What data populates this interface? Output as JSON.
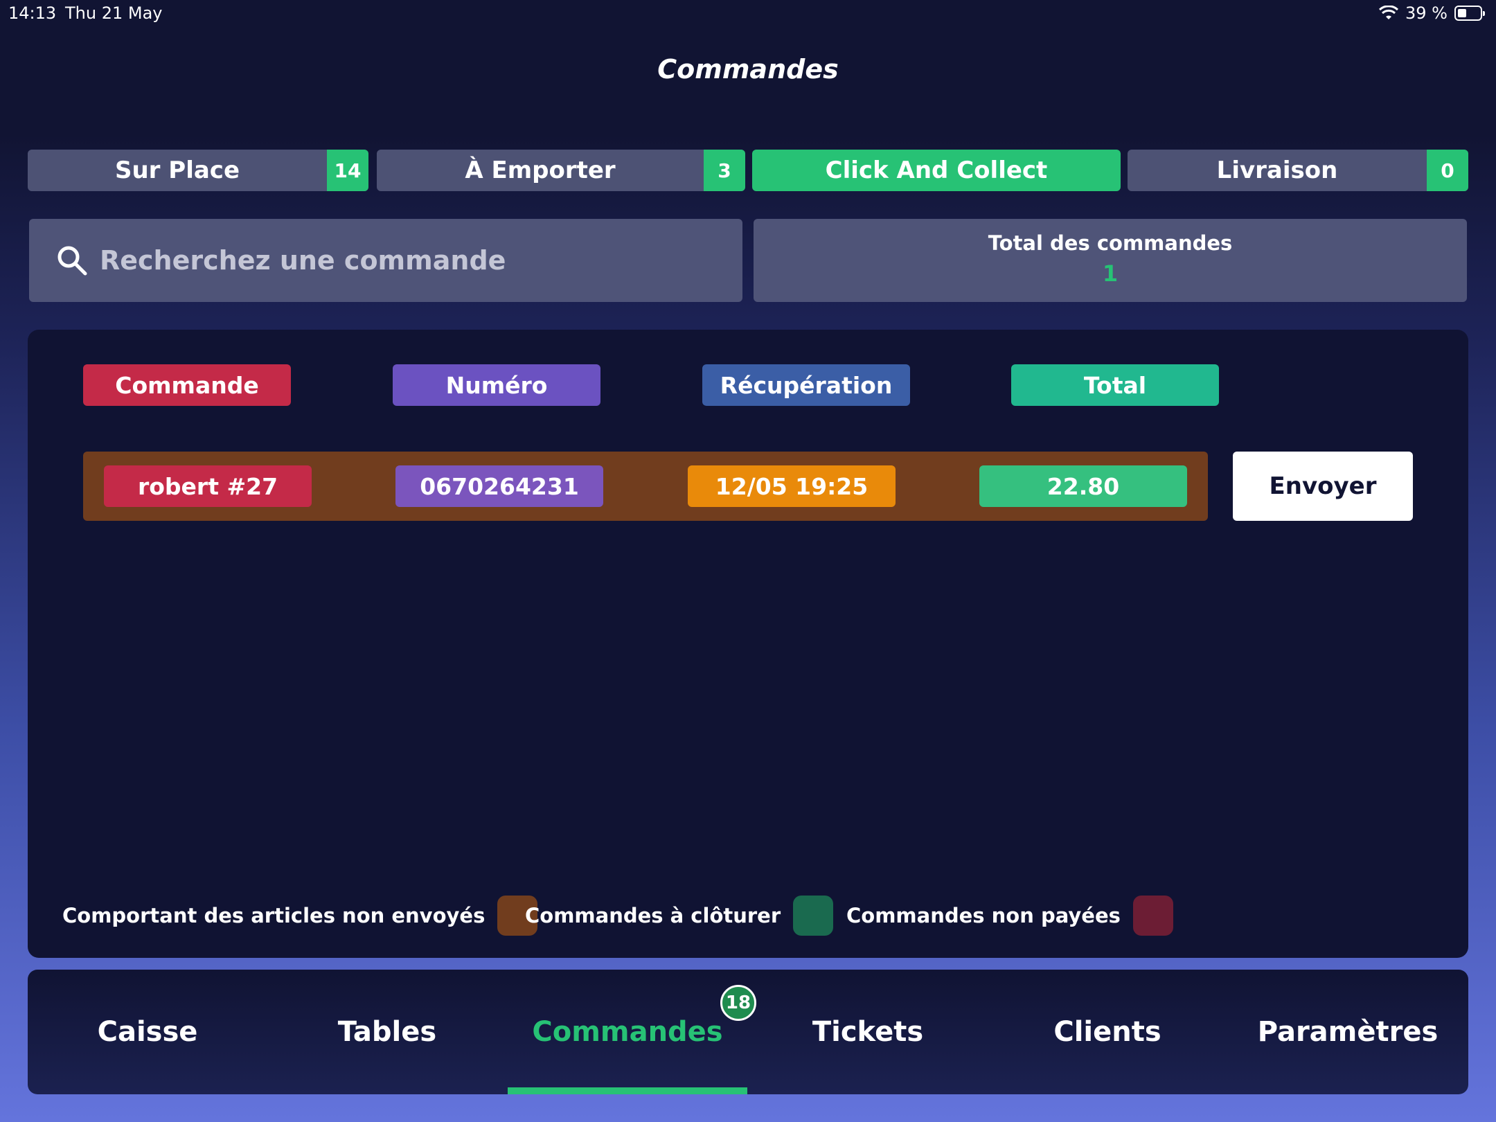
{
  "status_bar": {
    "time": "14:13",
    "date": "Thu 21 May",
    "battery": "39 %"
  },
  "header": {
    "title": "Commandes"
  },
  "tabs": [
    {
      "label": "Sur Place",
      "count": "14"
    },
    {
      "label": "À Emporter",
      "count": "3"
    },
    {
      "label": "Click And Collect",
      "count": ""
    },
    {
      "label": "Livraison",
      "count": "0"
    }
  ],
  "search": {
    "placeholder": "Recherchez une commande"
  },
  "totals": {
    "label": "Total des commandes",
    "value": "1"
  },
  "table": {
    "headers": [
      "Commande",
      "Numéro",
      "Récupération",
      "Total"
    ],
    "rows": [
      {
        "commande": "robert #27",
        "numero": "0670264231",
        "recuperation": "12/05 19:25",
        "total": "22.80",
        "action": "Envoyer"
      }
    ]
  },
  "legend": [
    {
      "label": "Comportant des articles non envoyés",
      "color": "#713d1e"
    },
    {
      "label": "Commandes à clôturer",
      "color": "#1a6a4f"
    },
    {
      "label": "Commandes non payées",
      "color": "#6c1d34"
    }
  ],
  "nav": {
    "items": [
      "Caisse",
      "Tables",
      "Commandes",
      "Tickets",
      "Clients",
      "Paramètres"
    ],
    "active": "Commandes",
    "badge": "18"
  },
  "colors": {
    "accent": "#27c275",
    "commande": "#c42a48",
    "numero": "#6b52c1",
    "recuperation": "#3b5ea6",
    "total": "#21b88f",
    "orange": "#e98a0a"
  }
}
